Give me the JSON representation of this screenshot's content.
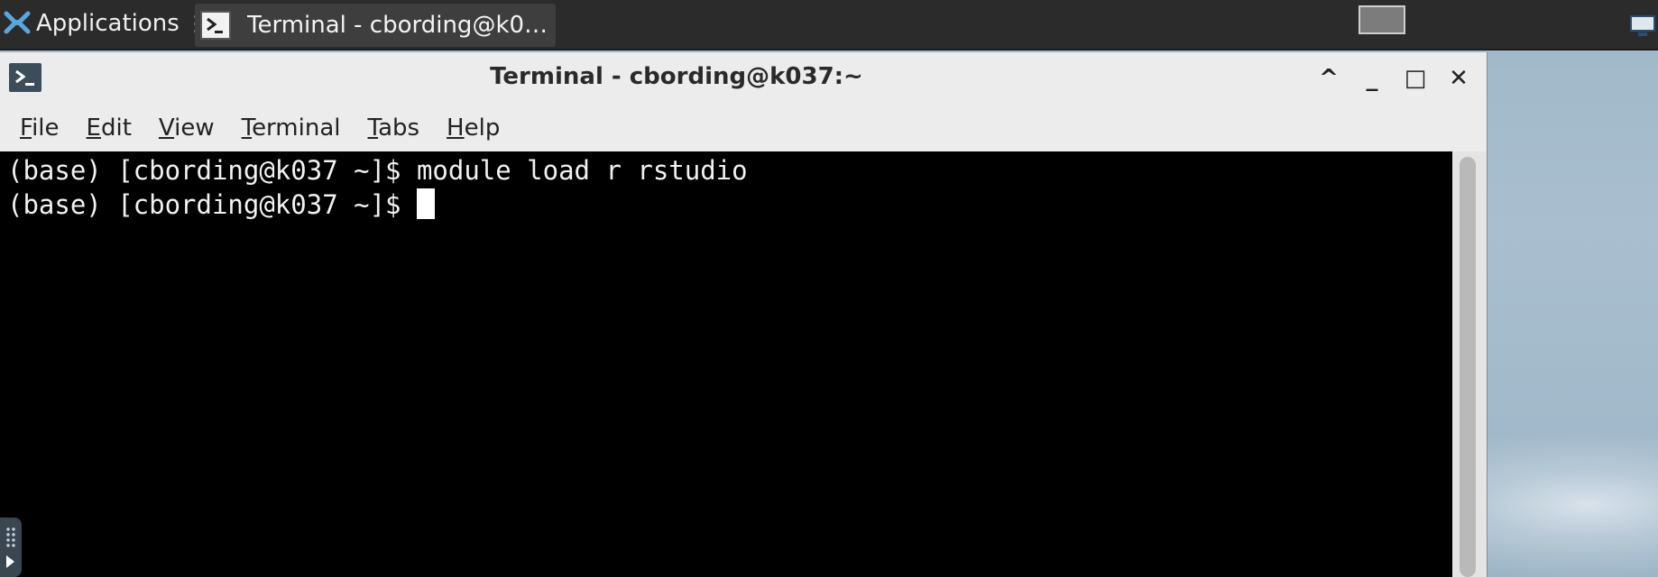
{
  "panel": {
    "applications_label": "Applications",
    "applications_separator": "⋮",
    "taskbar_title": "Terminal - cbording@k0…"
  },
  "window": {
    "title": "Terminal - cbording@k037:~",
    "buttons": {
      "up": "^",
      "minimize": "_",
      "maximize": "□",
      "close": "✕"
    },
    "menu": [
      {
        "mnemonic": "F",
        "rest": "ile"
      },
      {
        "mnemonic": "E",
        "rest": "dit"
      },
      {
        "mnemonic": "V",
        "rest": "iew"
      },
      {
        "mnemonic": "T",
        "rest": "erminal"
      },
      {
        "mnemonic": "T",
        "rest": "abs"
      },
      {
        "mnemonic": "H",
        "rest": "elp"
      }
    ]
  },
  "terminal": {
    "lines": [
      "(base) [cbording@k037 ~]$ module load r rstudio",
      "(base) [cbording@k037 ~]$ "
    ]
  },
  "colors": {
    "panel_bg": "#2b2b2b",
    "terminal_bg": "#000000",
    "terminal_fg": "#f2f2f2",
    "titlebar_bg": "#ececec"
  },
  "icons": {
    "applications": "xfce-mouse-icon",
    "terminal": "terminal-prompt-icon"
  }
}
